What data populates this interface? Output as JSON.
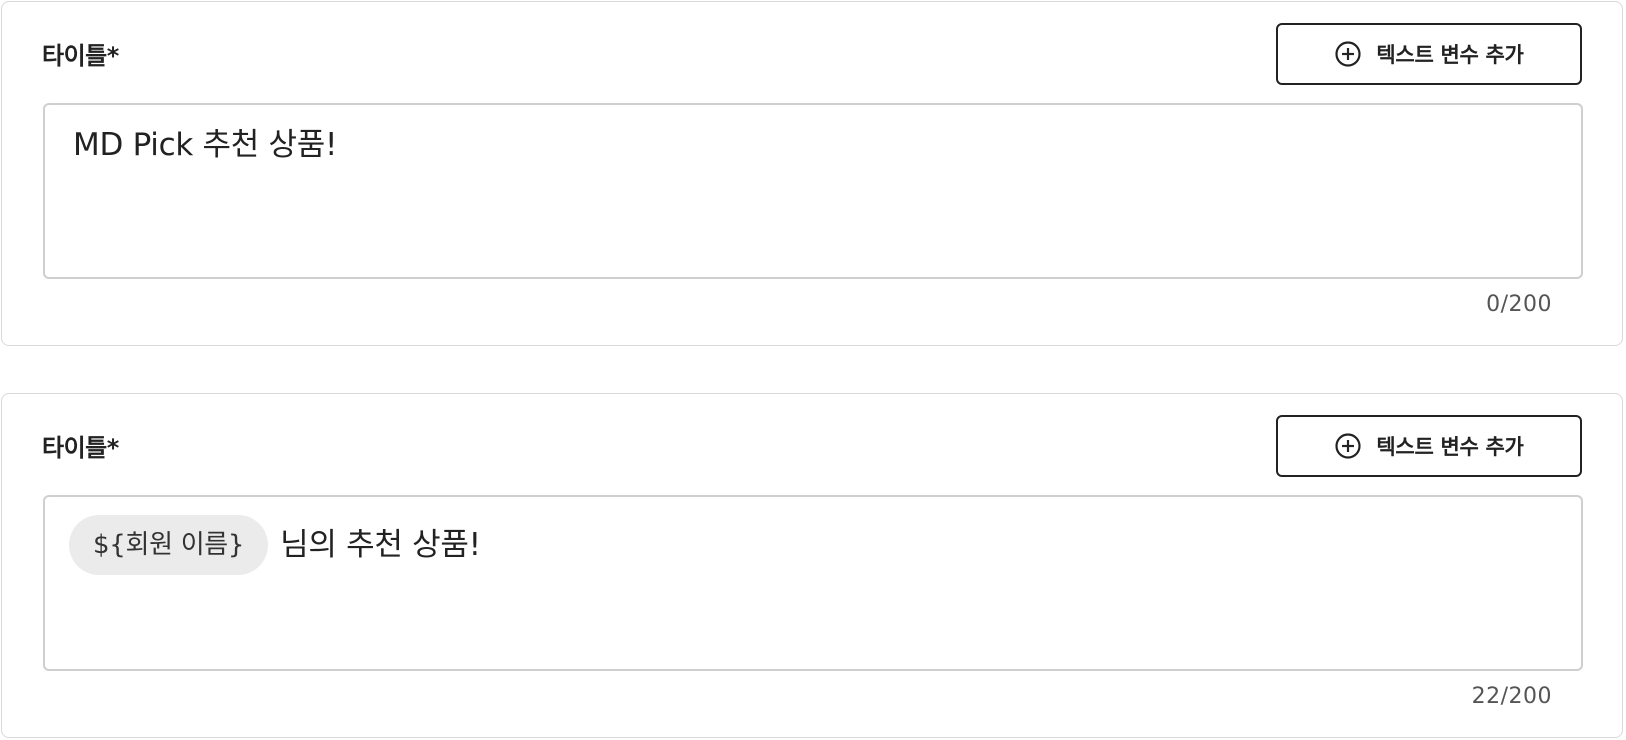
{
  "panels": [
    {
      "title": "타이틀*",
      "add_button_label": "텍스트 변수 추가",
      "add_button_icon": "plus-circle-icon",
      "text_value": "MD Pick 추천 상품!",
      "counter": "0/200"
    },
    {
      "title": "타이틀*",
      "add_button_label": "텍스트 변수 추가",
      "add_button_icon": "plus-circle-icon",
      "variable_chip": "${회원 이름}",
      "text_value": "님의 추천 상품!",
      "counter": "22/200"
    }
  ],
  "colors": {
    "text": "#222222",
    "border": "#d9d9d9",
    "chip_bg": "#ebebeb",
    "counter": "#555555"
  }
}
